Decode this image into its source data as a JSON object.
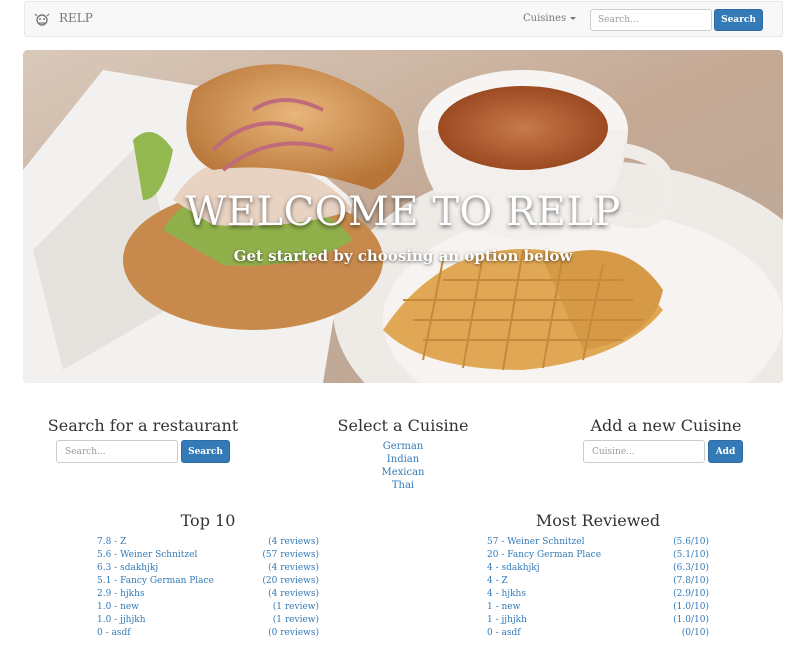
{
  "navbar": {
    "brand": "RELP",
    "cuisines_label": "Cuisines",
    "search_placeholder": "Search...",
    "search_button": "Search"
  },
  "hero": {
    "title": "WELCOME TO RELP",
    "subtitle": "Get started by choosing an option below"
  },
  "search_section": {
    "title": "Search for a restaurant",
    "placeholder": "Search...",
    "button": "Search"
  },
  "cuisine_section": {
    "title": "Select a Cuisine",
    "cuisines": [
      "German",
      "Indian",
      "Mexican",
      "Thai"
    ]
  },
  "add_section": {
    "title": "Add a new Cuisine",
    "placeholder": "Cuisine...",
    "button": "Add"
  },
  "top10": {
    "title": "Top 10",
    "items": [
      {
        "name": "7.8 - Z",
        "meta": "(4 reviews)"
      },
      {
        "name": "5.6 - Weiner Schnitzel",
        "meta": "(57 reviews)"
      },
      {
        "name": "6.3 - sdakhjkj",
        "meta": "(4 reviews)"
      },
      {
        "name": "5.1 - Fancy German Place",
        "meta": "(20 reviews)"
      },
      {
        "name": "2.9 - hjkhs",
        "meta": "(4 reviews)"
      },
      {
        "name": "1.0 - new",
        "meta": "(1 review)"
      },
      {
        "name": "1.0 - jjhjkh",
        "meta": "(1 review)"
      },
      {
        "name": "0 - asdf",
        "meta": "(0 reviews)"
      }
    ]
  },
  "most_reviewed": {
    "title": "Most Reviewed",
    "items": [
      {
        "name": "57 - Weiner Schnitzel",
        "meta": "(5.6/10)"
      },
      {
        "name": "20 - Fancy German Place",
        "meta": "(5.1/10)"
      },
      {
        "name": "4 - sdakhjkj",
        "meta": "(6.3/10)"
      },
      {
        "name": "4 - Z",
        "meta": "(7.8/10)"
      },
      {
        "name": "4 - hjkhs",
        "meta": "(2.9/10)"
      },
      {
        "name": "1 - new",
        "meta": "(1.0/10)"
      },
      {
        "name": "1 - jjhjkh",
        "meta": "(1.0/10)"
      },
      {
        "name": "0 - asdf",
        "meta": "(0/10)"
      }
    ]
  }
}
